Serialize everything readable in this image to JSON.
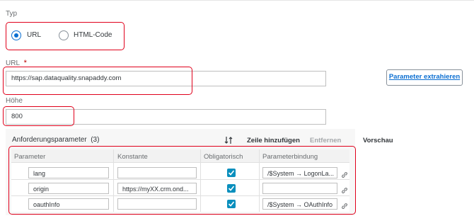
{
  "typ": {
    "label": "Typ",
    "options": [
      {
        "label": "URL",
        "selected": true
      },
      {
        "label": "HTML-Code",
        "selected": false
      }
    ]
  },
  "url": {
    "label": "URL",
    "required_mark": "*",
    "value": "https://sap.dataquality.snapaddy.com",
    "extract_button": "Parameter extrahieren"
  },
  "hoehe": {
    "label": "Höhe",
    "value": "800"
  },
  "params": {
    "title": "Anforderungsparameter",
    "count": "(3)",
    "sort_icon": "sort-icon",
    "add_row": "Zeile hinzufügen",
    "remove": "Entfernen",
    "preview_tab": "Vorschau",
    "columns": [
      "Parameter",
      "Konstante",
      "Obligatorisch",
      "Parameterbindung"
    ],
    "rows": [
      {
        "parameter": "lang",
        "konstante": "",
        "obligatorisch": true,
        "bindung": "/$System → LogonLa..."
      },
      {
        "parameter": "origin",
        "konstante": "https://myXX.crm.ond...",
        "obligatorisch": true,
        "bindung": ""
      },
      {
        "parameter": "oauthInfo",
        "konstante": "",
        "obligatorisch": true,
        "bindung": "/$System → OAuthInfo"
      }
    ]
  },
  "colors": {
    "accent": "#0a6ed1",
    "highlight_border": "#e0001b",
    "checkbox": "#0a8fbd",
    "required": "#bb0000"
  }
}
